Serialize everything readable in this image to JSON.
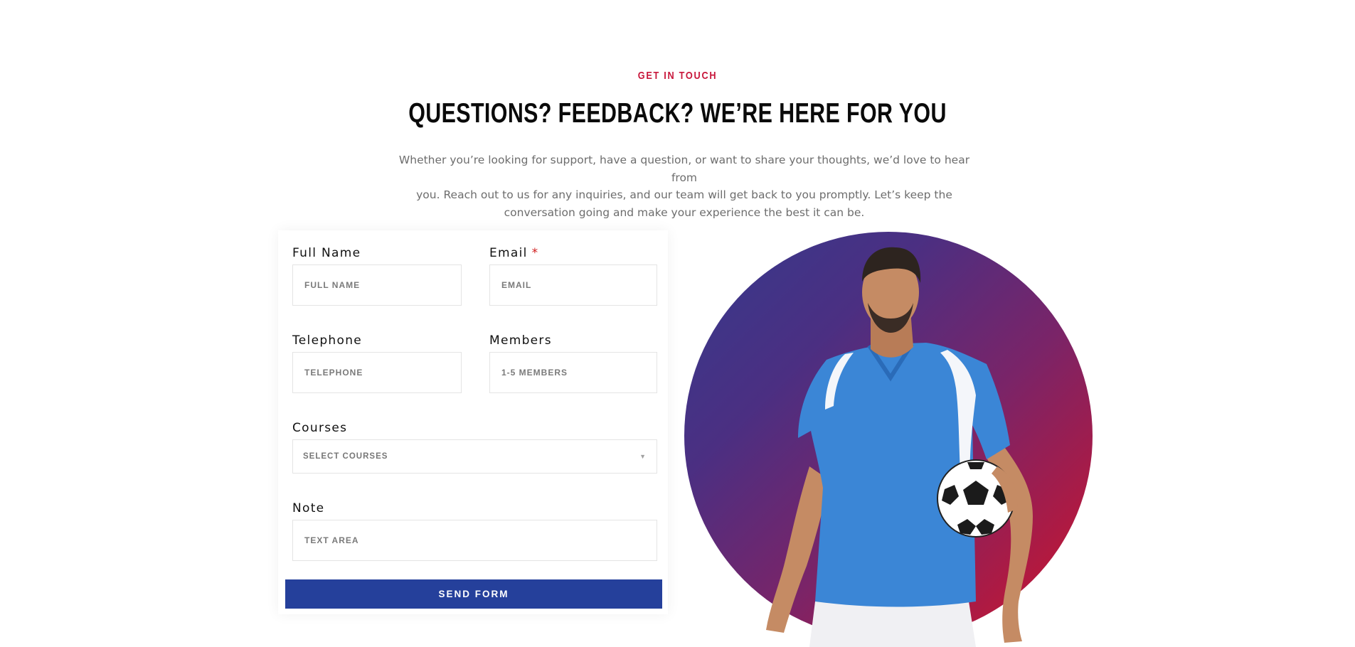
{
  "section": {
    "eyebrow": "GET IN TOUCH",
    "heading": "QUESTIONS? FEEDBACK? WE’RE HERE FOR YOU",
    "intro_lines": [
      "Whether you’re looking for support, have a question, or want to share your thoughts, we’d love to hear from",
      "you. Reach out to us for any inquiries, and our team will get back to you promptly. Let’s keep the",
      "conversation going and make your experience the best it can be."
    ]
  },
  "form": {
    "full_name": {
      "label": "Full Name",
      "placeholder": "FULL NAME",
      "value": ""
    },
    "email": {
      "label": "Email",
      "required_mark": "*",
      "placeholder": "EMAIL",
      "value": ""
    },
    "telephone": {
      "label": "Telephone",
      "placeholder": "TELEPHONE",
      "value": ""
    },
    "members": {
      "label": "Members",
      "placeholder": "1-5 MEMBERS",
      "value": ""
    },
    "courses": {
      "label": "Courses",
      "selected": "SELECT COURSES"
    },
    "note": {
      "label": "Note",
      "placeholder": "TEXT AREA",
      "value": ""
    },
    "submit_label": "SEND FORM"
  },
  "colors": {
    "accent_red": "#c8173b",
    "button_blue": "#25409b",
    "gradient_start": "#353a8c",
    "gradient_end": "#c8173b",
    "jersey_blue": "#3b86d6"
  },
  "icons": {
    "select_caret": "triangle-down"
  }
}
